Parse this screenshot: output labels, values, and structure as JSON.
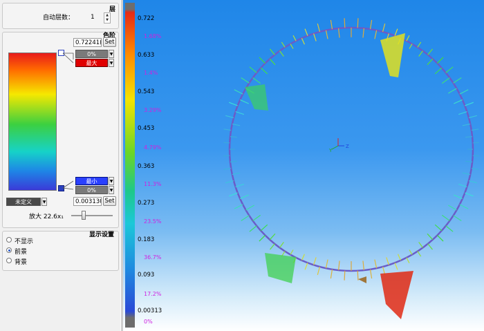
{
  "layers": {
    "title": "层",
    "auto_label": "自动层数：",
    "auto_value": "1"
  },
  "palette": {
    "title": "色阶",
    "max_value": "0.72241(",
    "set_label": "Set",
    "top_pct": "0%",
    "top_mode": "最大",
    "bottom_mode": "最小",
    "bottom_pct": "0%",
    "undefined_label": "未定义",
    "min_value": "0.003130",
    "zoom_label": "放大 22.6x₁"
  },
  "display": {
    "title": "显示设置",
    "options": [
      "不显示",
      "前景",
      "背景"
    ],
    "selected": 1
  },
  "scale": {
    "ticks": [
      "0.722",
      "0.633",
      "0.543",
      "0.453",
      "0.363",
      "0.273",
      "0.183",
      "0.093",
      "0.00313"
    ],
    "percents": [
      "1.68%",
      "1.4%",
      "3.29%",
      "4.79%",
      "11.3%",
      "23.5%",
      "36.7%",
      "17.2%",
      "0%"
    ]
  },
  "colors": {
    "accent_red": "#e00000",
    "accent_blue": "#2a40ff",
    "viewport_top": "#1f86e8",
    "percent_text": "#d020e0"
  },
  "icons": [
    "spin-up-icon",
    "spin-down-icon",
    "dropdown-arrow-icon",
    "axis-triad-icon",
    "slider-thumb-icon"
  ]
}
